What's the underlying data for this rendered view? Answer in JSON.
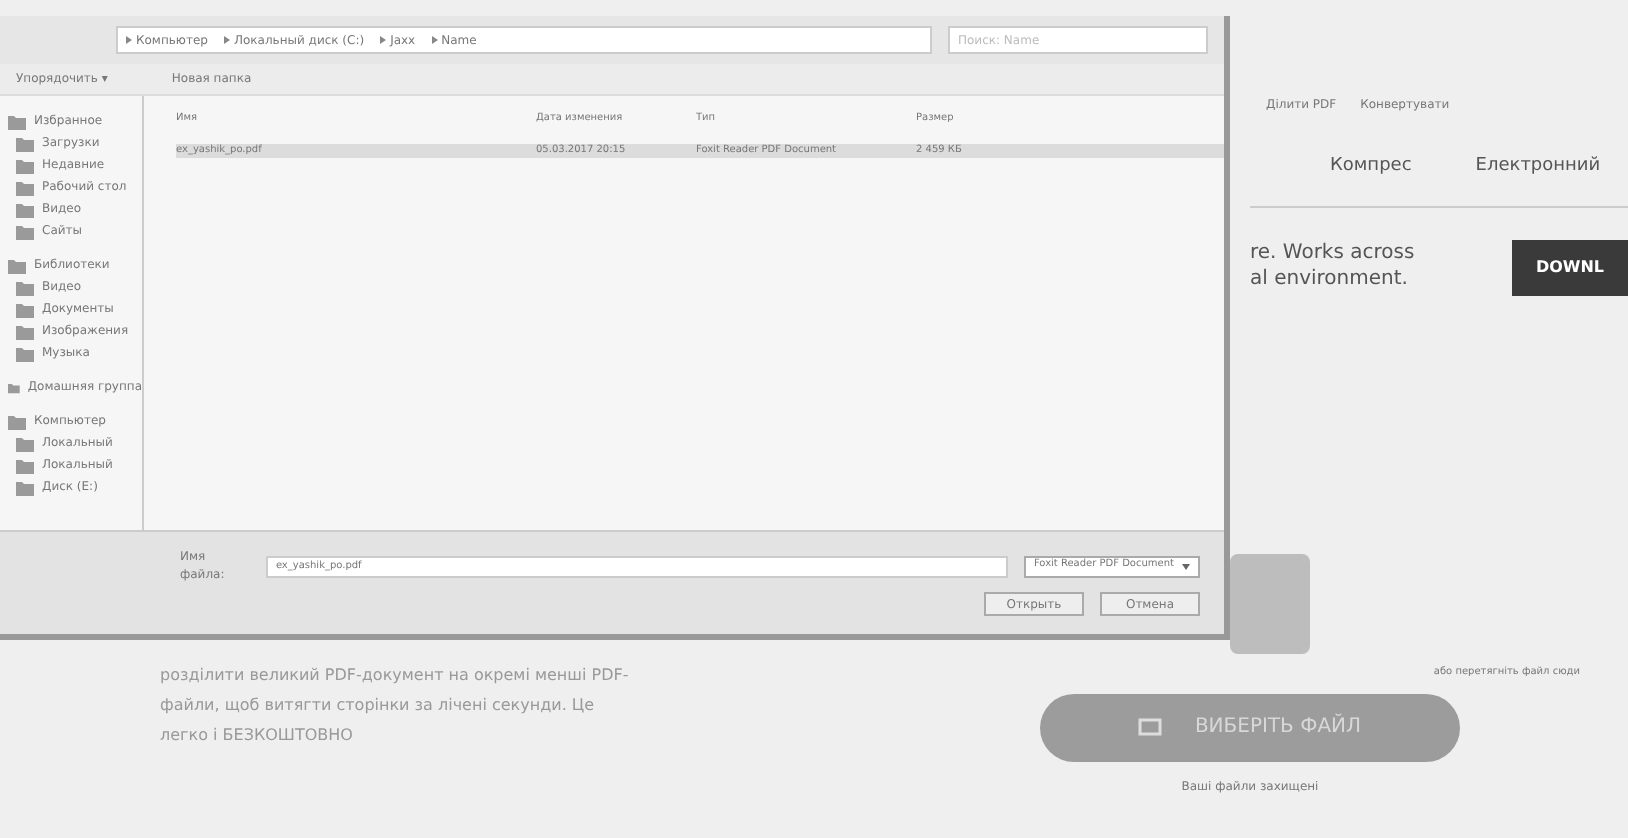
{
  "dialog": {
    "breadcrumb": [
      "Компьютер",
      "Локальный диск (C:)",
      "Jaxx",
      "Name"
    ],
    "search": {
      "placeholder": "Поиск: Name"
    },
    "toolbar": {
      "organize": "Упорядочить ▾",
      "new_folder": "Новая папка"
    },
    "sidebar": [
      {
        "label": "Избранное",
        "children": [
          {
            "label": "Загрузки"
          },
          {
            "label": "Недавние"
          },
          {
            "label": "Рабочий стол"
          },
          {
            "label": "Видео"
          },
          {
            "label": "Сайты"
          }
        ]
      },
      {
        "label": "Библиотеки",
        "children": [
          {
            "label": "Видео"
          },
          {
            "label": "Документы"
          },
          {
            "label": "Изображения"
          },
          {
            "label": "Музыка"
          }
        ]
      },
      {
        "label": "Домашняя группа"
      },
      {
        "label": "Компьютер",
        "children": [
          {
            "label": "Локальный"
          },
          {
            "label": "Локальный"
          },
          {
            "label": "Диск (E:)"
          }
        ]
      }
    ],
    "columns": [
      "Имя",
      "Дата изменения",
      "Тип",
      "Размер"
    ],
    "files": [
      {
        "name": "ex_yashik_po.pdf",
        "date": "05.03.2017 20:15",
        "type": "Foxit Reader PDF Document",
        "size": "2 459 КБ",
        "selected": true
      }
    ],
    "filename_label": "Имя файла:",
    "filename": "ex_yashik_po.pdf",
    "filetype": "Foxit Reader PDF Document",
    "open": "Открыть",
    "cancel": "Отмена"
  },
  "site": {
    "nav": [
      "Ділити PDF",
      "Конвертувати"
    ],
    "menu": [
      "Компрес",
      "Електронний"
    ],
    "promo": [
      "re. Works across",
      "al environment."
    ],
    "download": "DOWNL",
    "description": "розділити великий PDF-документ на окремі менші PDF-файли, щоб витягти сторінки за лічені секунди. Це легко і БЕЗКОШТОВНО",
    "drop_hint": "або перетягніть файл сюди",
    "choose": "ВИБЕРІТЬ ФАЙЛ",
    "note": "Ваші файли захищені"
  }
}
